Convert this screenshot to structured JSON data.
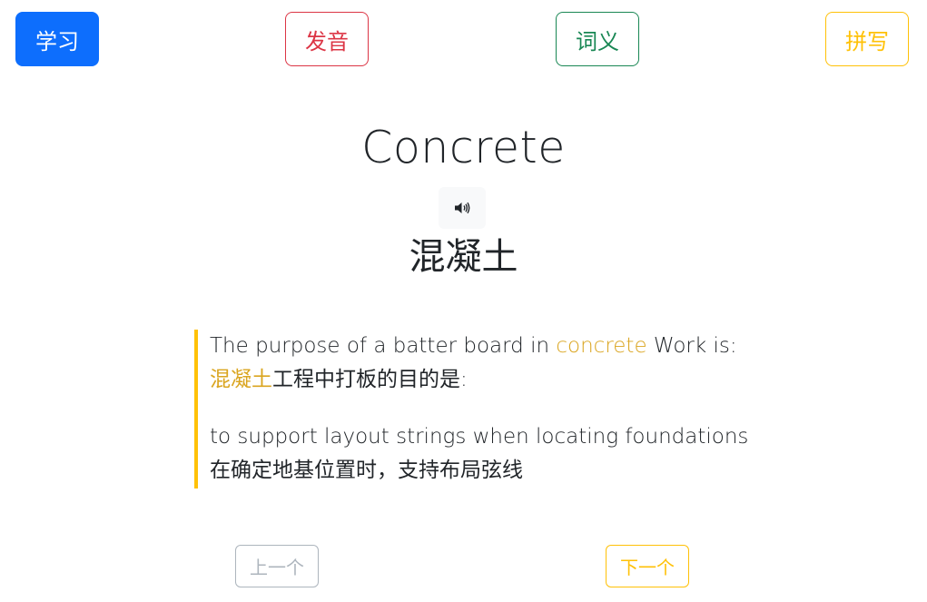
{
  "modes": {
    "study": "学习",
    "pronunciation": "发音",
    "meaning": "词义",
    "spelling": "拼写"
  },
  "word": {
    "text": "Concrete",
    "translation": "混凝土",
    "speaker_icon": "speaker-icon"
  },
  "example": {
    "en_before": "The purpose of a batter board in ",
    "en_highlight": "concrete",
    "en_after": " Work is:",
    "zh_highlight": "混凝土",
    "zh_after": "工程中打板的目的是:",
    "answer_en": "to support layout strings when locating foundations",
    "answer_zh": "在确定地基位置时，支持布局弦线"
  },
  "nav": {
    "prev": "上一个",
    "next": "下一个"
  },
  "colors": {
    "primary": "#0d6efd",
    "danger": "#dc3545",
    "success": "#198754",
    "warning": "#ffc107",
    "highlight": "#daa520",
    "disabled": "#adb5bd"
  }
}
